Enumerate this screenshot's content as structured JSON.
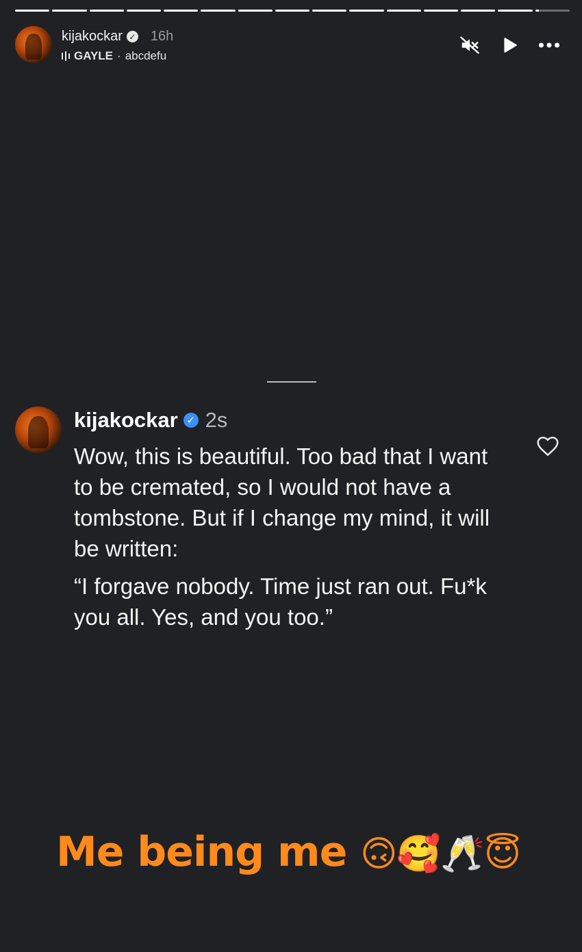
{
  "story": {
    "username": "kijakockar",
    "time": "16h",
    "music": {
      "artist": "GAYLE",
      "separator": "·",
      "title": "abcdefu"
    },
    "segments_total": 15,
    "controls": [
      "mute-icon",
      "play-icon",
      "more-icon"
    ]
  },
  "comment": {
    "username": "kijakockar",
    "time": "2s",
    "text": "Wow, this is beautiful. Too bad that I want to be cremated, so I would not have a tombstone. But if I change my mind, it will be written:",
    "quote": "“I forgave nobody. Time just ran out. Fu*k you all. Yes, and you too.”"
  },
  "caption": {
    "text": "Me being me",
    "emojis": "🙃🥰🥂😇"
  },
  "colors": {
    "background": "#202125",
    "caption": "#ff8a1c",
    "verified": "#3b8ff5"
  }
}
